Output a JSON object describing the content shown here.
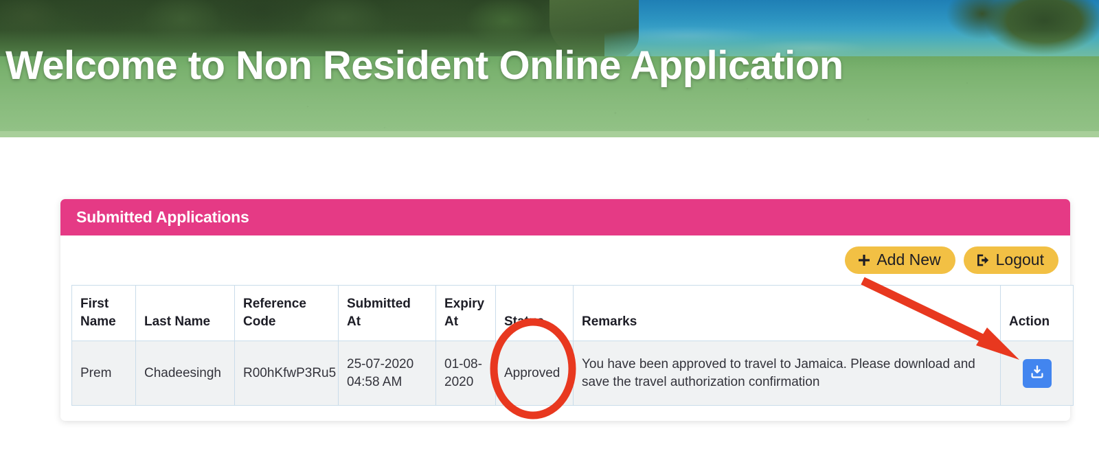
{
  "hero": {
    "title": "Welcome to Non Resident Online Application",
    "image_description": "tropical-cove-beach-photo"
  },
  "card": {
    "title": "Submitted Applications"
  },
  "toolbar": {
    "add_new_label": "Add New",
    "add_new_icon": "plus-icon",
    "logout_label": "Logout",
    "logout_icon": "sign-out-icon",
    "button_color": "#f2c044"
  },
  "table": {
    "columns": [
      "First Name",
      "Last Name",
      "Reference Code",
      "Submitted At",
      "Expiry At",
      "Status",
      "Remarks",
      "Action"
    ],
    "rows": [
      {
        "first_name": "Prem",
        "last_name": "Chadeesingh",
        "reference_code": "R00hKfwP3Ru5",
        "submitted_at": "25-07-2020 04:58 AM",
        "expiry_at": "01-08-2020",
        "status": "Approved",
        "remarks": "You have been approved to travel to Jamaica. Please download and save the travel authorization confirmation",
        "action_icon": "download-icon",
        "action_color": "#4285ef"
      }
    ]
  },
  "annotations": {
    "color": "#e8381f",
    "circle_target": "Status",
    "arrow_target": "Action download button"
  }
}
